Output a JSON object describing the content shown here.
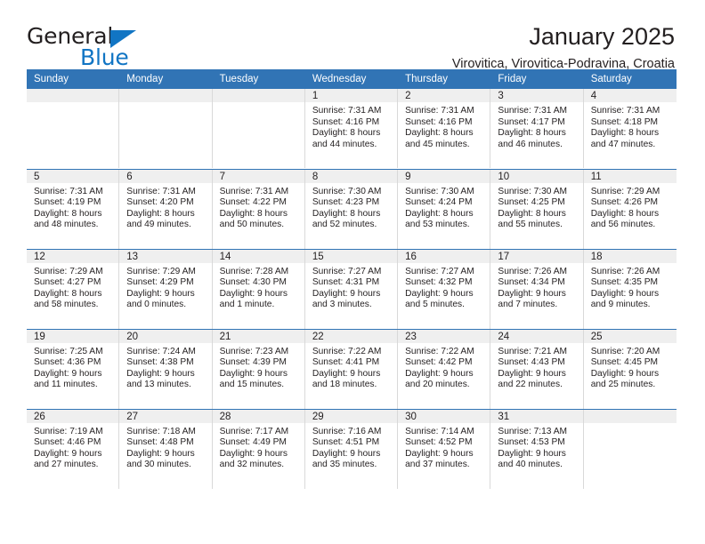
{
  "brand": {
    "name_part1": "General",
    "name_part2": "Blue",
    "triangle_icon": "triangle-icon",
    "colors": {
      "dark": "#231f20",
      "blue": "#1175c4"
    }
  },
  "header": {
    "title": "January 2025",
    "subtitle": "Virovitica, Virovitica-Podravina, Croatia"
  },
  "theme": {
    "header_blue": "#3174b5",
    "daynum_band": "#efefef",
    "cell_border": "#d9d9d9",
    "text": "#231f20"
  },
  "calendar": {
    "weekday_headers": [
      "Sunday",
      "Monday",
      "Tuesday",
      "Wednesday",
      "Thursday",
      "Friday",
      "Saturday"
    ],
    "weeks": [
      [
        {
          "day": "",
          "lines": []
        },
        {
          "day": "",
          "lines": []
        },
        {
          "day": "",
          "lines": []
        },
        {
          "day": "1",
          "lines": [
            "Sunrise: 7:31 AM",
            "Sunset: 4:16 PM",
            "Daylight: 8 hours",
            "and 44 minutes."
          ]
        },
        {
          "day": "2",
          "lines": [
            "Sunrise: 7:31 AM",
            "Sunset: 4:16 PM",
            "Daylight: 8 hours",
            "and 45 minutes."
          ]
        },
        {
          "day": "3",
          "lines": [
            "Sunrise: 7:31 AM",
            "Sunset: 4:17 PM",
            "Daylight: 8 hours",
            "and 46 minutes."
          ]
        },
        {
          "day": "4",
          "lines": [
            "Sunrise: 7:31 AM",
            "Sunset: 4:18 PM",
            "Daylight: 8 hours",
            "and 47 minutes."
          ]
        }
      ],
      [
        {
          "day": "5",
          "lines": [
            "Sunrise: 7:31 AM",
            "Sunset: 4:19 PM",
            "Daylight: 8 hours",
            "and 48 minutes."
          ]
        },
        {
          "day": "6",
          "lines": [
            "Sunrise: 7:31 AM",
            "Sunset: 4:20 PM",
            "Daylight: 8 hours",
            "and 49 minutes."
          ]
        },
        {
          "day": "7",
          "lines": [
            "Sunrise: 7:31 AM",
            "Sunset: 4:22 PM",
            "Daylight: 8 hours",
            "and 50 minutes."
          ]
        },
        {
          "day": "8",
          "lines": [
            "Sunrise: 7:30 AM",
            "Sunset: 4:23 PM",
            "Daylight: 8 hours",
            "and 52 minutes."
          ]
        },
        {
          "day": "9",
          "lines": [
            "Sunrise: 7:30 AM",
            "Sunset: 4:24 PM",
            "Daylight: 8 hours",
            "and 53 minutes."
          ]
        },
        {
          "day": "10",
          "lines": [
            "Sunrise: 7:30 AM",
            "Sunset: 4:25 PM",
            "Daylight: 8 hours",
            "and 55 minutes."
          ]
        },
        {
          "day": "11",
          "lines": [
            "Sunrise: 7:29 AM",
            "Sunset: 4:26 PM",
            "Daylight: 8 hours",
            "and 56 minutes."
          ]
        }
      ],
      [
        {
          "day": "12",
          "lines": [
            "Sunrise: 7:29 AM",
            "Sunset: 4:27 PM",
            "Daylight: 8 hours",
            "and 58 minutes."
          ]
        },
        {
          "day": "13",
          "lines": [
            "Sunrise: 7:29 AM",
            "Sunset: 4:29 PM",
            "Daylight: 9 hours",
            "and 0 minutes."
          ]
        },
        {
          "day": "14",
          "lines": [
            "Sunrise: 7:28 AM",
            "Sunset: 4:30 PM",
            "Daylight: 9 hours",
            "and 1 minute."
          ]
        },
        {
          "day": "15",
          "lines": [
            "Sunrise: 7:27 AM",
            "Sunset: 4:31 PM",
            "Daylight: 9 hours",
            "and 3 minutes."
          ]
        },
        {
          "day": "16",
          "lines": [
            "Sunrise: 7:27 AM",
            "Sunset: 4:32 PM",
            "Daylight: 9 hours",
            "and 5 minutes."
          ]
        },
        {
          "day": "17",
          "lines": [
            "Sunrise: 7:26 AM",
            "Sunset: 4:34 PM",
            "Daylight: 9 hours",
            "and 7 minutes."
          ]
        },
        {
          "day": "18",
          "lines": [
            "Sunrise: 7:26 AM",
            "Sunset: 4:35 PM",
            "Daylight: 9 hours",
            "and 9 minutes."
          ]
        }
      ],
      [
        {
          "day": "19",
          "lines": [
            "Sunrise: 7:25 AM",
            "Sunset: 4:36 PM",
            "Daylight: 9 hours",
            "and 11 minutes."
          ]
        },
        {
          "day": "20",
          "lines": [
            "Sunrise: 7:24 AM",
            "Sunset: 4:38 PM",
            "Daylight: 9 hours",
            "and 13 minutes."
          ]
        },
        {
          "day": "21",
          "lines": [
            "Sunrise: 7:23 AM",
            "Sunset: 4:39 PM",
            "Daylight: 9 hours",
            "and 15 minutes."
          ]
        },
        {
          "day": "22",
          "lines": [
            "Sunrise: 7:22 AM",
            "Sunset: 4:41 PM",
            "Daylight: 9 hours",
            "and 18 minutes."
          ]
        },
        {
          "day": "23",
          "lines": [
            "Sunrise: 7:22 AM",
            "Sunset: 4:42 PM",
            "Daylight: 9 hours",
            "and 20 minutes."
          ]
        },
        {
          "day": "24",
          "lines": [
            "Sunrise: 7:21 AM",
            "Sunset: 4:43 PM",
            "Daylight: 9 hours",
            "and 22 minutes."
          ]
        },
        {
          "day": "25",
          "lines": [
            "Sunrise: 7:20 AM",
            "Sunset: 4:45 PM",
            "Daylight: 9 hours",
            "and 25 minutes."
          ]
        }
      ],
      [
        {
          "day": "26",
          "lines": [
            "Sunrise: 7:19 AM",
            "Sunset: 4:46 PM",
            "Daylight: 9 hours",
            "and 27 minutes."
          ]
        },
        {
          "day": "27",
          "lines": [
            "Sunrise: 7:18 AM",
            "Sunset: 4:48 PM",
            "Daylight: 9 hours",
            "and 30 minutes."
          ]
        },
        {
          "day": "28",
          "lines": [
            "Sunrise: 7:17 AM",
            "Sunset: 4:49 PM",
            "Daylight: 9 hours",
            "and 32 minutes."
          ]
        },
        {
          "day": "29",
          "lines": [
            "Sunrise: 7:16 AM",
            "Sunset: 4:51 PM",
            "Daylight: 9 hours",
            "and 35 minutes."
          ]
        },
        {
          "day": "30",
          "lines": [
            "Sunrise: 7:14 AM",
            "Sunset: 4:52 PM",
            "Daylight: 9 hours",
            "and 37 minutes."
          ]
        },
        {
          "day": "31",
          "lines": [
            "Sunrise: 7:13 AM",
            "Sunset: 4:53 PM",
            "Daylight: 9 hours",
            "and 40 minutes."
          ]
        },
        {
          "day": "",
          "lines": []
        }
      ]
    ]
  }
}
